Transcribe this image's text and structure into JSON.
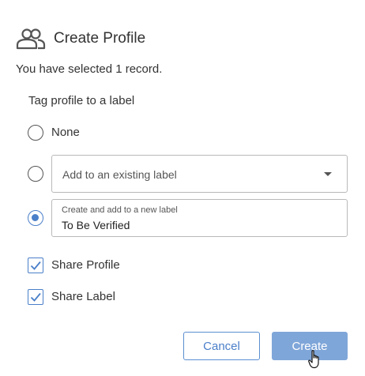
{
  "dialog": {
    "title": "Create Profile",
    "title_icon": "people-icon",
    "subtitle": "You have selected 1 record."
  },
  "label_section": {
    "heading": "Tag profile to a label",
    "options": [
      {
        "label": "None",
        "selected": false
      },
      {
        "label": "",
        "selected": false
      },
      {
        "label": "",
        "selected": true
      }
    ],
    "existing_label_dropdown": {
      "placeholder": "Add to an existing label",
      "icon": "caret-down-icon"
    },
    "new_label_field": {
      "floating_label": "Create and add to a new label",
      "value": "To Be Verified"
    }
  },
  "checkboxes": [
    {
      "label": "Share Profile",
      "checked": true
    },
    {
      "label": "Share Label",
      "checked": true
    }
  ],
  "actions": {
    "cancel_label": "Cancel",
    "create_label": "Create"
  },
  "colors": {
    "accent": "#4a7fc9",
    "create_button_bg": "#7fa6d9",
    "text": "#333333",
    "border": "#b9b9b9"
  }
}
